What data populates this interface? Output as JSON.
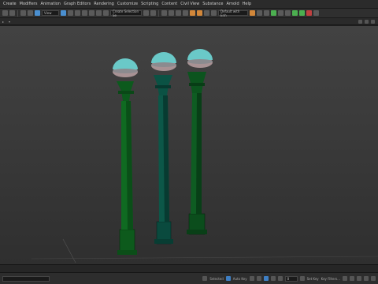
{
  "menu": {
    "items": [
      "Create",
      "Modifiers",
      "Animation",
      "Graph Editors",
      "Rendering",
      "Customize",
      "Scripting",
      "Content",
      "Civil View",
      "Substance",
      "Arnold",
      "Help"
    ]
  },
  "toolbar": {
    "view_dropdown": "View",
    "selection_set": "Create Selection Se",
    "workspace": "Default with Enh"
  },
  "status": {
    "prompt": "Selected",
    "autokey_label": "Auto Key",
    "frame_field": "0",
    "setkey_label": "Set Key",
    "filters": "Key Filters..."
  },
  "colors": {
    "pole_left": "#0d5a1c",
    "pole_middle": "#0a4a3e",
    "pole_right": "#0b4d1c",
    "globe_top": "#6ac9c8",
    "globe_bottom": "#a89294"
  },
  "icons": [
    "undo-icon",
    "redo-icon",
    "link-icon",
    "unlink-icon",
    "select-icon",
    "move-icon",
    "rotate-icon",
    "scale-icon",
    "snap-icon",
    "mirror-icon",
    "align-icon",
    "render-icon"
  ]
}
